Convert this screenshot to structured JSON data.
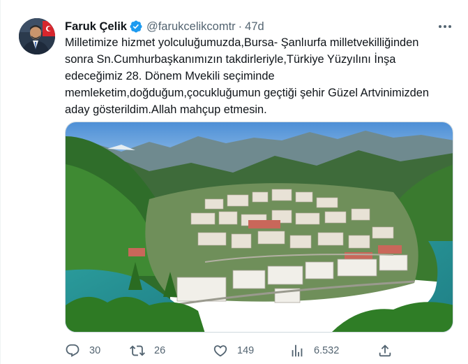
{
  "tweet": {
    "author_name": "Faruk Çelik",
    "handle": "@farukcelikcomtr",
    "separator": "·",
    "time": "47d",
    "text_lines": [
      "Milletimize hizmet yolculuğumuzda,Bursa- Şanlıurfa milletvekilliğinden",
      "sonra Sn.Cumhurbaşkanımızın takdirleriyle,Türkiye Yüzyılını İnşa",
      "edeceğimiz 28. Dönem Mvekili seçiminde",
      "memleketim,doğduğum,çocukluğumun geçtiği şehir Güzel Artvinimizden",
      "aday gösterildim.Allah mahçup etmesin."
    ],
    "verified_color": "#1d9bf0",
    "icons": {
      "avatar": "avatar",
      "verified": "verified-badge-icon",
      "more": "more-icon",
      "reply": "reply-icon",
      "retweet": "retweet-icon",
      "like": "like-icon",
      "views": "views-icon",
      "share": "share-icon"
    }
  },
  "actions": {
    "replies": "30",
    "retweets": "26",
    "likes": "149",
    "views": "6.532"
  },
  "colors": {
    "text": "#0f1419",
    "secondary": "#536471",
    "border": "#cfd9de"
  }
}
